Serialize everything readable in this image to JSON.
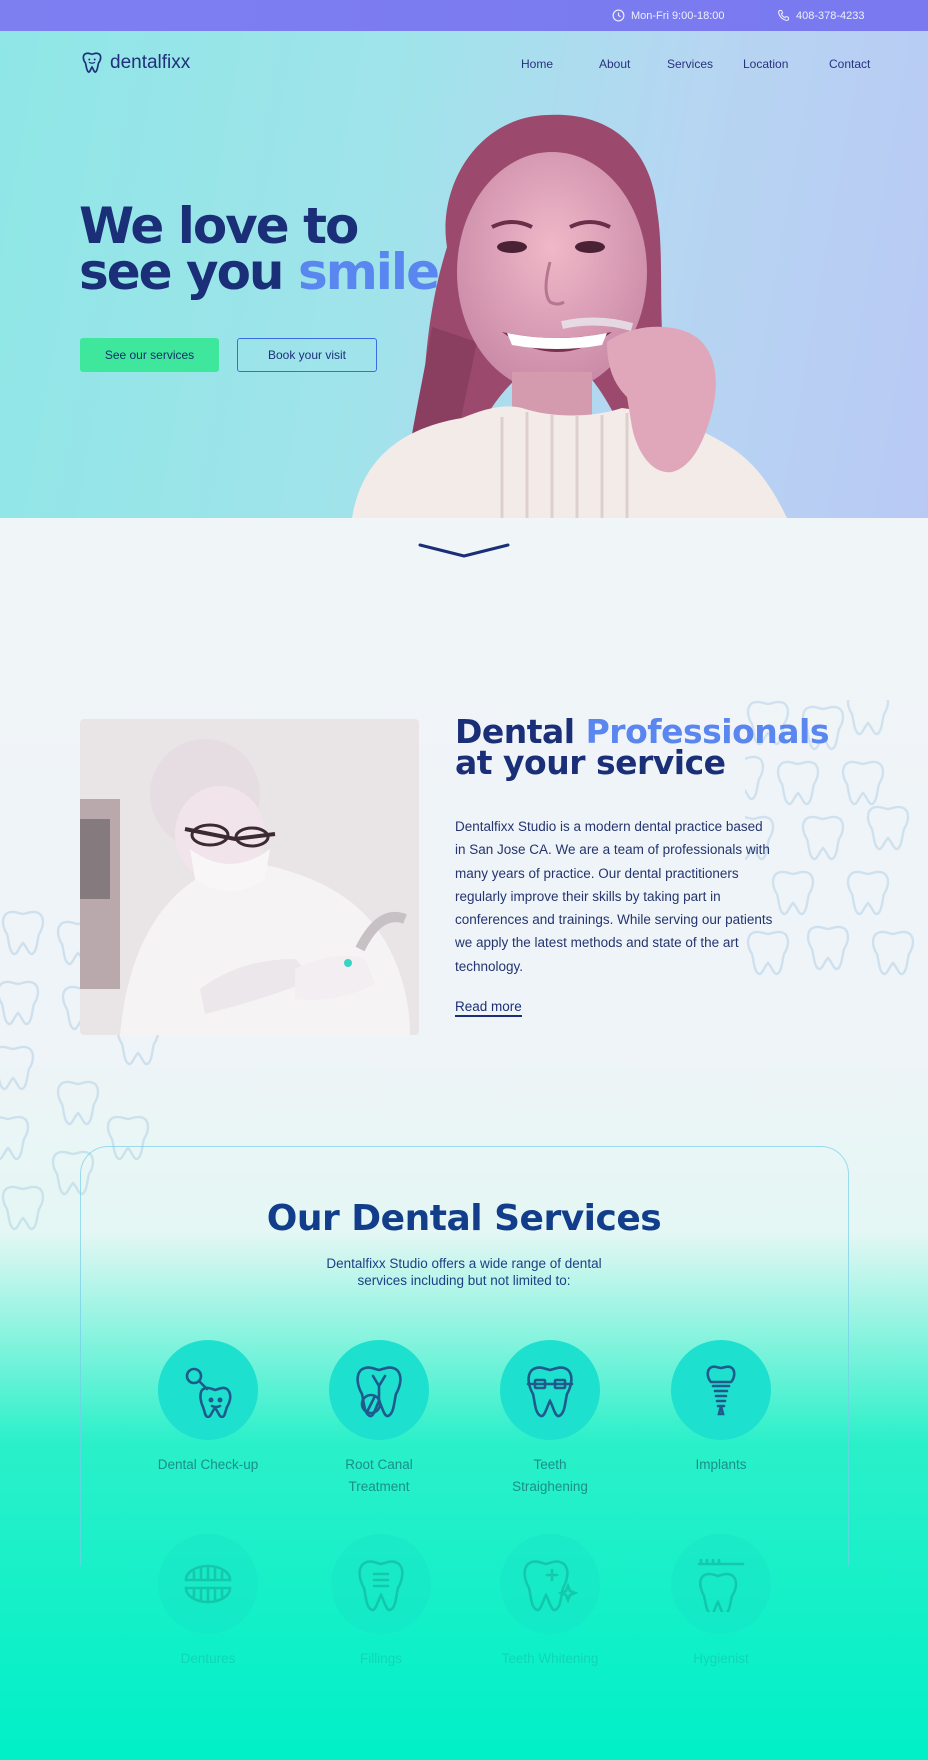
{
  "topbar": {
    "hours": "Mon-Fri 9:00-18:00",
    "phone": "408-378-4233"
  },
  "brand": {
    "name": "dentalfixx",
    "colors": {
      "navy": "#1b2f78",
      "accent_blue": "#5a86ef",
      "mint": "#3fe79c",
      "teal": "#1ee0cf",
      "topbar": "#7d7ff1"
    }
  },
  "nav": {
    "items": [
      "Home",
      "About",
      "Services",
      "Location",
      "Contact"
    ]
  },
  "hero": {
    "line1": "We love to",
    "line2_a": "see you ",
    "line2_b": "smile",
    "btn_primary": "See our services",
    "btn_outline": "Book your visit"
  },
  "about": {
    "title_a": "Dental ",
    "title_b": "Professionals",
    "title_c": "at your service",
    "text": "Dentalfixx Studio is a modern dental practice based in San Jose CA. We are a team of professionals with many years of practice. Our dental practitioners regularly improve their skills by taking part in conferences and trainings. While serving our patients we apply the latest methods and state of the art technology.",
    "read_more": "Read more"
  },
  "services": {
    "title": "Our Dental Services",
    "subtitle": "Dentalfixx Studio offers a wide range of dental services including but not limited to:",
    "items": [
      {
        "label_1": "Dental Check-up",
        "label_2": "",
        "icon": "tooth-mirror-icon"
      },
      {
        "label_1": "Root Canal",
        "label_2": "Treatment",
        "icon": "tooth-root-icon"
      },
      {
        "label_1": "Teeth",
        "label_2": "Straighening",
        "icon": "tooth-braces-icon"
      },
      {
        "label_1": "Implants",
        "label_2": "",
        "icon": "tooth-implant-icon"
      },
      {
        "label_1": "Dentures",
        "label_2": "",
        "icon": "dentures-icon"
      },
      {
        "label_1": "Fillings",
        "label_2": "",
        "icon": "tooth-filling-icon"
      },
      {
        "label_1": "Teeth Whitening",
        "label_2": "",
        "icon": "tooth-sparkle-icon"
      },
      {
        "label_1": "Hygienist",
        "label_2": "",
        "icon": "tooth-brush-icon"
      }
    ]
  }
}
